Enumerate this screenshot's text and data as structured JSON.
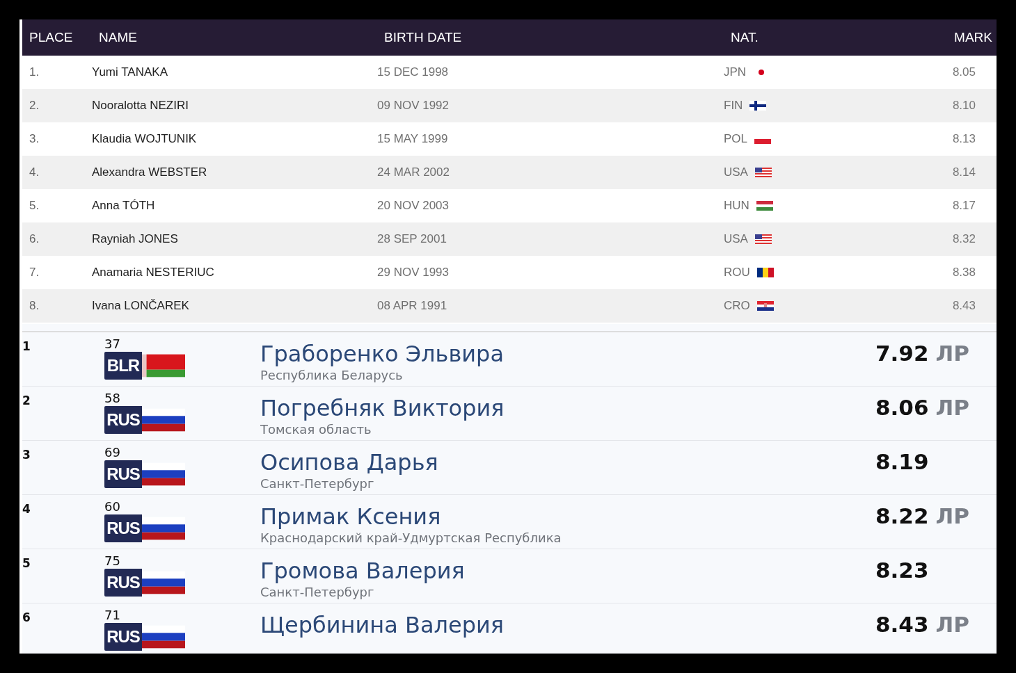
{
  "results_table": {
    "columns": [
      "PLACE",
      "NAME",
      "BIRTH DATE",
      "NAT.",
      "MARK"
    ],
    "rows": [
      {
        "place": "1.",
        "name": "Yumi TANAKA",
        "birth_date": "15 DEC 1998",
        "nat": "JPN",
        "kind": "japan",
        "mark": "8.05"
      },
      {
        "place": "2.",
        "name": "Nooralotta NEZIRI",
        "birth_date": "09 NOV 1992",
        "nat": "FIN",
        "kind": "finland",
        "mark": "8.10"
      },
      {
        "place": "3.",
        "name": "Klaudia WOJTUNIK",
        "birth_date": "15 MAY 1999",
        "nat": "POL",
        "kind": "poland",
        "mark": "8.13"
      },
      {
        "place": "4.",
        "name": "Alexandra WEBSTER",
        "birth_date": "24 MAR 2002",
        "nat": "USA",
        "kind": "usa",
        "mark": "8.14"
      },
      {
        "place": "5.",
        "name": "Anna TÓTH",
        "birth_date": "20 NOV 2003",
        "nat": "HUN",
        "kind": "hungary",
        "mark": "8.17"
      },
      {
        "place": "6.",
        "name": "Rayniah JONES",
        "birth_date": "28 SEP 2001",
        "nat": "USA",
        "kind": "usa",
        "mark": "8.32"
      },
      {
        "place": "7.",
        "name": "Anamaria NESTERIUC",
        "birth_date": "29 NOV 1993",
        "nat": "ROU",
        "kind": "romania",
        "mark": "8.38"
      },
      {
        "place": "8.",
        "name": "Ivana LONČAREK",
        "birth_date": "08 APR 1991",
        "nat": "CRO",
        "kind": "croatia",
        "mark": "8.43"
      }
    ]
  },
  "ranking": [
    {
      "place": "1",
      "bib": "37",
      "code": "BLR",
      "kind": "belarus",
      "name": "Граборенко Эльвира",
      "region": "Республика Беларусь",
      "mark": "7.92",
      "note": "ЛР"
    },
    {
      "place": "2",
      "bib": "58",
      "code": "RUS",
      "kind": "russia",
      "name": "Погребняк Виктория",
      "region": "Томская область",
      "mark": "8.06",
      "note": "ЛР"
    },
    {
      "place": "3",
      "bib": "69",
      "code": "RUS",
      "kind": "russia",
      "name": "Осипова Дарья",
      "region": "Санкт-Петербург",
      "mark": "8.19"
    },
    {
      "place": "4",
      "bib": "60",
      "code": "RUS",
      "kind": "russia",
      "name": "Примак Ксения",
      "region": "Краснодарский край-Удмуртская Республика",
      "mark": "8.22",
      "note": "ЛР"
    },
    {
      "place": "5",
      "bib": "75",
      "code": "RUS",
      "kind": "russia",
      "name": "Громова Валерия",
      "region": "Санкт-Петербург",
      "mark": "8.23"
    },
    {
      "place": "6",
      "bib": "71",
      "code": "RUS",
      "kind": "russia",
      "name": "Щербинина Валерия",
      "mark": "8.43",
      "note": "ЛР"
    }
  ]
}
